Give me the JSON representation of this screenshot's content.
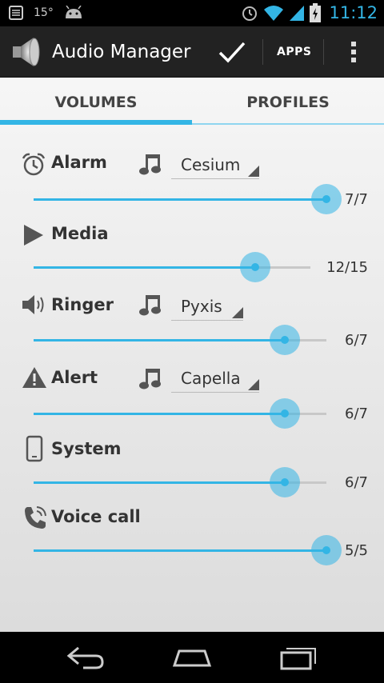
{
  "status_bar": {
    "temperature": "15°",
    "time": "11:12",
    "icons": [
      "notes-icon",
      "android-icon",
      "alarm-clock-icon",
      "wifi-icon",
      "signal-icon",
      "battery-charging-icon"
    ]
  },
  "action_bar": {
    "title": "Audio Manager",
    "apps_label": "APPS",
    "icons": [
      "speaker-logo-icon",
      "check-icon",
      "overflow-menu-icon"
    ]
  },
  "tabs": [
    {
      "label": "VOLUMES",
      "selected": true
    },
    {
      "label": "PROFILES",
      "selected": false
    }
  ],
  "rows": [
    {
      "label": "Alarm",
      "icon": "alarm-clock-icon",
      "tone": "Cesium",
      "level_text": "7/7",
      "value": 7,
      "max": 7
    },
    {
      "label": "Media",
      "icon": "play-icon",
      "tone": null,
      "level_text": "12/15",
      "value": 12,
      "max": 15
    },
    {
      "label": "Ringer",
      "icon": "speaker-icon",
      "tone": "Pyxis",
      "level_text": "6/7",
      "value": 6,
      "max": 7
    },
    {
      "label": "Alert",
      "icon": "warning-icon",
      "tone": "Capella",
      "level_text": "6/7",
      "value": 6,
      "max": 7
    },
    {
      "label": "System",
      "icon": "phone-icon",
      "tone": null,
      "level_text": "6/7",
      "value": 6,
      "max": 7
    },
    {
      "label": "Voice call",
      "icon": "call-icon",
      "tone": null,
      "level_text": "5/5",
      "value": 5,
      "max": 5
    }
  ],
  "nav_bar": {
    "icons": [
      "back-icon",
      "home-icon",
      "recents-icon"
    ]
  },
  "colors": {
    "accent": "#33b5e5",
    "actionbar": "#222222"
  }
}
